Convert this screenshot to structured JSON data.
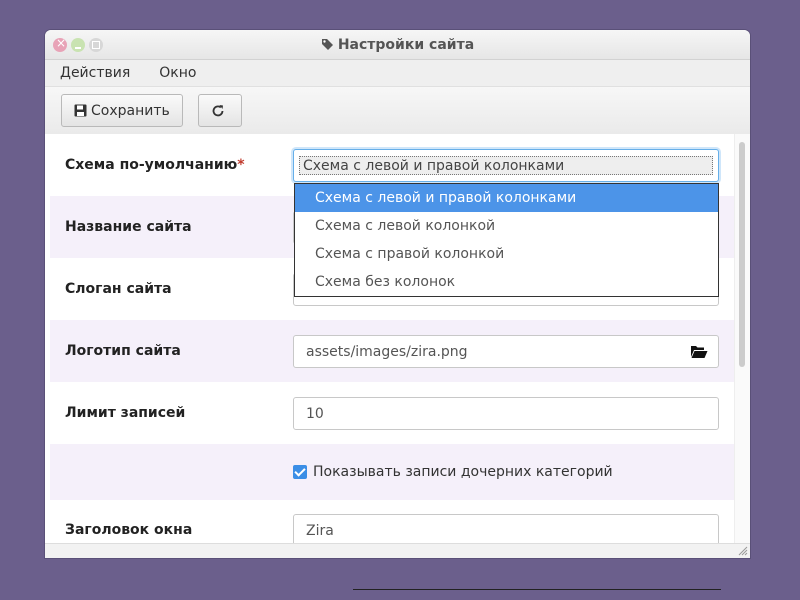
{
  "window": {
    "title": "Настройки сайта"
  },
  "menu": {
    "actions": "Действия",
    "window": "Окно"
  },
  "toolbar": {
    "save": "Сохранить"
  },
  "form": {
    "layout_label": "Схема по-умолчанию",
    "layout_required": "*",
    "layout_value": "Схема с левой и правой колонками",
    "site_name_label": "Название сайта",
    "slogan_label": "Слоган сайта",
    "logo_label": "Логотип сайта",
    "logo_value": "assets/images/zira.png",
    "limit_label": "Лимит записей",
    "limit_value": "10",
    "show_children_label": "Показывать записи дочерних категорий",
    "show_children_checked": true,
    "window_title_label": "Заголовок окна",
    "window_title_value": "Zira"
  },
  "dropdown": {
    "options": [
      "Схема с левой и правой колонками",
      "Схема с левой колонкой",
      "Схема с правой колонкой",
      "Схема без колонок"
    ],
    "selected_index": 0
  },
  "colors": {
    "background": "#6b5f8c",
    "accent": "#4c94e8",
    "row_alt": "#f5f0fa",
    "required": "#c0392b"
  },
  "icons": [
    "tag-icon",
    "save-icon",
    "refresh-icon",
    "folder-open-icon",
    "checkbox-checked-icon",
    "resize-grip-icon"
  ]
}
